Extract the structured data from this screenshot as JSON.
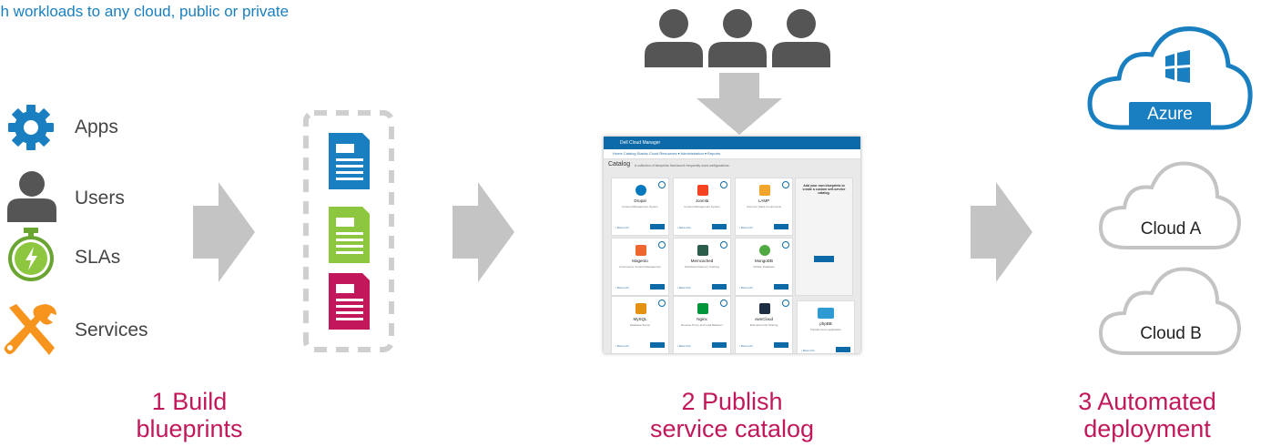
{
  "headline": "ch workloads to any cloud, public or private",
  "legend": [
    {
      "label": "Apps",
      "icon": "gear-icon"
    },
    {
      "label": "Users",
      "icon": "user-icon"
    },
    {
      "label": "SLAs",
      "icon": "stopwatch-icon"
    },
    {
      "label": "Services",
      "icon": "tools-icon"
    }
  ],
  "steps": {
    "build": {
      "line1": "1 Build",
      "line2": "blueprints"
    },
    "publish": {
      "line1": "2 Publish",
      "line2": "service catalog"
    },
    "deploy": {
      "line1": "3 Automated",
      "line2": "deployment"
    }
  },
  "clouds": {
    "azure": "Azure",
    "a": "Cloud A",
    "b": "Cloud B"
  },
  "catalog": {
    "app_title": "Dell Cloud Manager",
    "nav": "Home   Catalog   Stacks   Cloud Resources ▾   Administration ▾   Reports",
    "title": "Catalog",
    "subtitle": "A collection of blueprints that launch frequently used configurations.",
    "cards": [
      {
        "name": "Drupal",
        "desc": "Content Management System"
      },
      {
        "name": "Joomla",
        "desc": "Content Management System"
      },
      {
        "name": "LAMP",
        "desc": "Common Stack Components"
      },
      {
        "name": "Magento",
        "desc": "eCommerce Content Management"
      },
      {
        "name": "Memcached",
        "desc": "Distributed Memory Caching"
      },
      {
        "name": "MongoDB",
        "desc": "NoSQL Database"
      },
      {
        "name": "MySQL",
        "desc": "Database Server"
      },
      {
        "name": "Nginx",
        "desc": "Reverse Proxy and Load Balancer"
      },
      {
        "name": "ownCloud",
        "desc": "Enterprise File Sharing"
      },
      {
        "name": "phpBB",
        "desc": "Popular forum application"
      }
    ],
    "panel_title": "Add your own blueprints to create a custom self-service catalog."
  },
  "colors": {
    "blue": "#1a7fc1",
    "green": "#8dc63f",
    "magenta": "#c2185b",
    "orange": "#f7941d",
    "arrow": "#c4c4c4",
    "person": "#555555"
  }
}
